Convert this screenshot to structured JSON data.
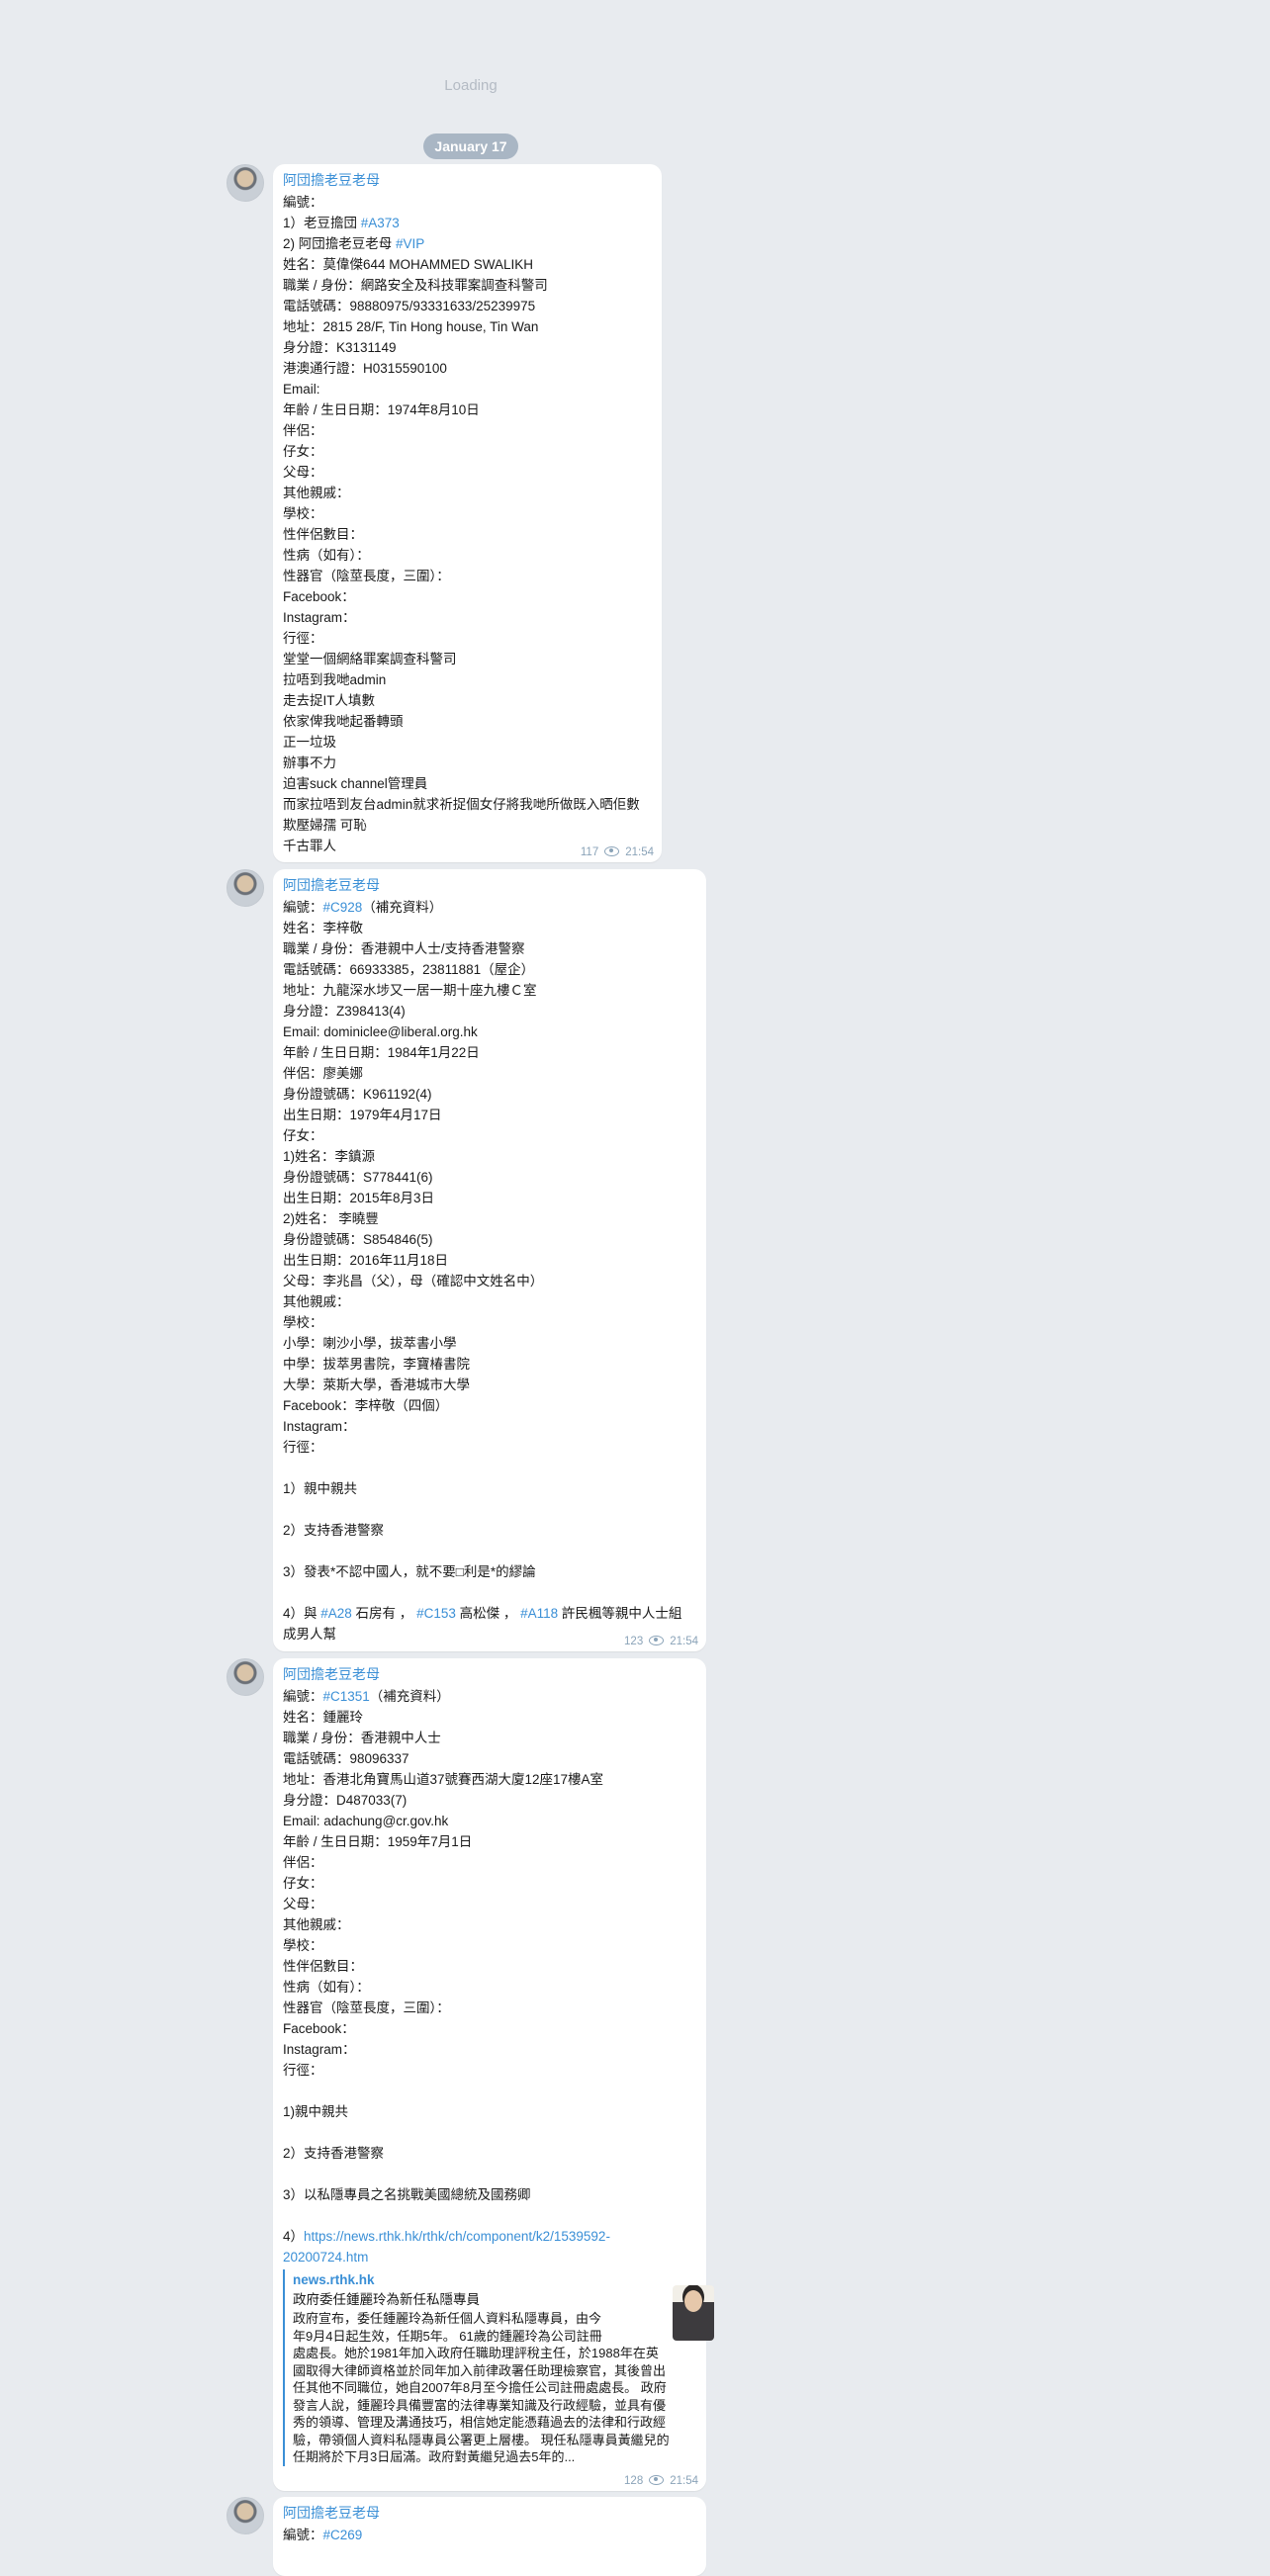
{
  "loading_text": "Loading",
  "date_label": "January 17",
  "messages": [
    {
      "sender": "阿団擔老豆老母",
      "views": "117",
      "time": "21:54",
      "lines": [
        "編號：",
        "1）老豆擔団 #A373",
        "2) 阿団擔老豆老母 #VIP",
        "姓名：莫偉傑644 MOHAMMED SWALIKH",
        "職業 / 身份：網路安全及科技罪案調查科警司",
        "電話號碼：98880975/93331633/25239975",
        "地址：2815 28/F, Tin Hong house, Tin Wan",
        "身分證：K3131149",
        "港澳通行證：H0315590100",
        "Email:",
        "年齡 / 生日日期：1974年8月10日",
        "伴侶：",
        "仔女：",
        "父母：",
        "其他親戚：",
        "學校：",
        "性伴侶數目：",
        "性病（如有）：",
        "性器官（陰莖長度，三圍）：",
        "Facebook：",
        "Instagram：",
        "行徑：",
        "堂堂一個網絡罪案調查科警司",
        "拉唔到我哋admin",
        "走去捉IT人填數",
        "依家俾我哋起番轉頭",
        "正一垃圾",
        "辦事不力",
        "迫害suck channel管理員",
        "而家拉唔到友台admin就求祈捉個女仔將我哋所做既入晒佢數",
        "欺壓婦孺 可恥",
        "千古罪人"
      ]
    },
    {
      "sender": "阿団擔老豆老母",
      "views": "123",
      "time": "21:54",
      "lines": [
        "編號：#C928（補充資料）",
        "姓名：李梓敬",
        "職業 / 身份：香港親中人士/支持香港警察",
        "電話號碼：66933385，23811881（屋企）",
        "地址：九龍深水埗又一居一期十座九樓Ｃ室",
        "身分證：Z398413(4)",
        "Email: dominiclee@liberal.org.hk",
        "年齡 / 生日日期：1984年1月22日",
        "伴侶：廖美娜",
        "身份證號碼：K961192(4)",
        "出生日期：1979年4月17日",
        "仔女：",
        "1)姓名：李鎮源",
        "身份證號碼：S778441(6)",
        "出生日期：2015年8月3日",
        "2)姓名： 李曉豐",
        "身份證號碼：S854846(5)",
        "出生日期：2016年11月18日",
        "父母：李兆昌（父），母（確認中文姓名中）",
        "其他親戚：",
        "學校：",
        "小學：喇沙小學，拔萃書小學",
        "中學：拔萃男書院，李寶椿書院",
        "大學：萊斯大學，香港城市大學",
        "Facebook：李梓敬（四個）",
        "Instagram：",
        "行徑：",
        "",
        "1）親中親共",
        "",
        "2）支持香港警察",
        "",
        "3）發表*不認中國人，就不要□利是*的繆論",
        "",
        "4）與 #A28 石房有 ， #C153 高松傑 ， #A118 許民楓等親中人士組",
        "成男人幫"
      ]
    },
    {
      "sender": "阿団擔老豆老母",
      "views": "128",
      "time": "21:54",
      "lines": [
        "編號：#C1351（補充資料）",
        "姓名：鍾麗玲",
        "職業 / 身份：香港親中人士",
        "電話號碼：98096337",
        "地址：香港北角寶馬山道37號賽西湖大廈12座17樓A室",
        "身分證：D487033(7)",
        "Email: adachung@cr.gov.hk",
        "年齡 / 生日日期：1959年7月1日",
        "伴侶：",
        "仔女：",
        "父母：",
        "其他親戚：",
        "學校：",
        "性伴侶數目：",
        "性病（如有）：",
        "性器官（陰莖長度，三圍）：",
        "Facebook：",
        "Instagram：",
        "行徑：",
        "",
        "1)親中親共",
        "",
        "2）支持香港警察",
        "",
        "3）以私隱專員之名挑戰美國總統及國務卿",
        "",
        "4）https://news.rthk.hk/rthk/ch/component/k2/1539592-",
        "20200724.htm"
      ],
      "preview": {
        "site": "news.rthk.hk",
        "title": "政府委任鍾麗玲為新任私隱專員",
        "lines": [
          "政府宣布，委任鍾麗玲為新任個人資料私隱專員，由今",
          "年9月4日起生效，任期5年。 61歲的鍾麗玲為公司註冊",
          "處處長。她於1981年加入政府任職助理評稅主任，於1988年在英",
          "國取得大律師資格並於同年加入前律政署任助理檢察官，其後曾出",
          "任其他不同職位，她自2007年8月至今擔任公司註冊處處長。 政府",
          "發言人說，鍾麗玲具備豐富的法律專業知識及行政經驗，並具有優",
          "秀的領導、管理及溝通技巧，相信她定能憑藉過去的法律和行政經",
          "驗，帶領個人資料私隱專員公署更上層樓。 現任私隱專員黃繼兒的",
          "任期將於下月3日屆滿。政府對黃繼兒過去5年的..."
        ]
      }
    },
    {
      "sender": "阿団擔老豆老母",
      "lines": [
        "編號：#C269"
      ]
    }
  ]
}
